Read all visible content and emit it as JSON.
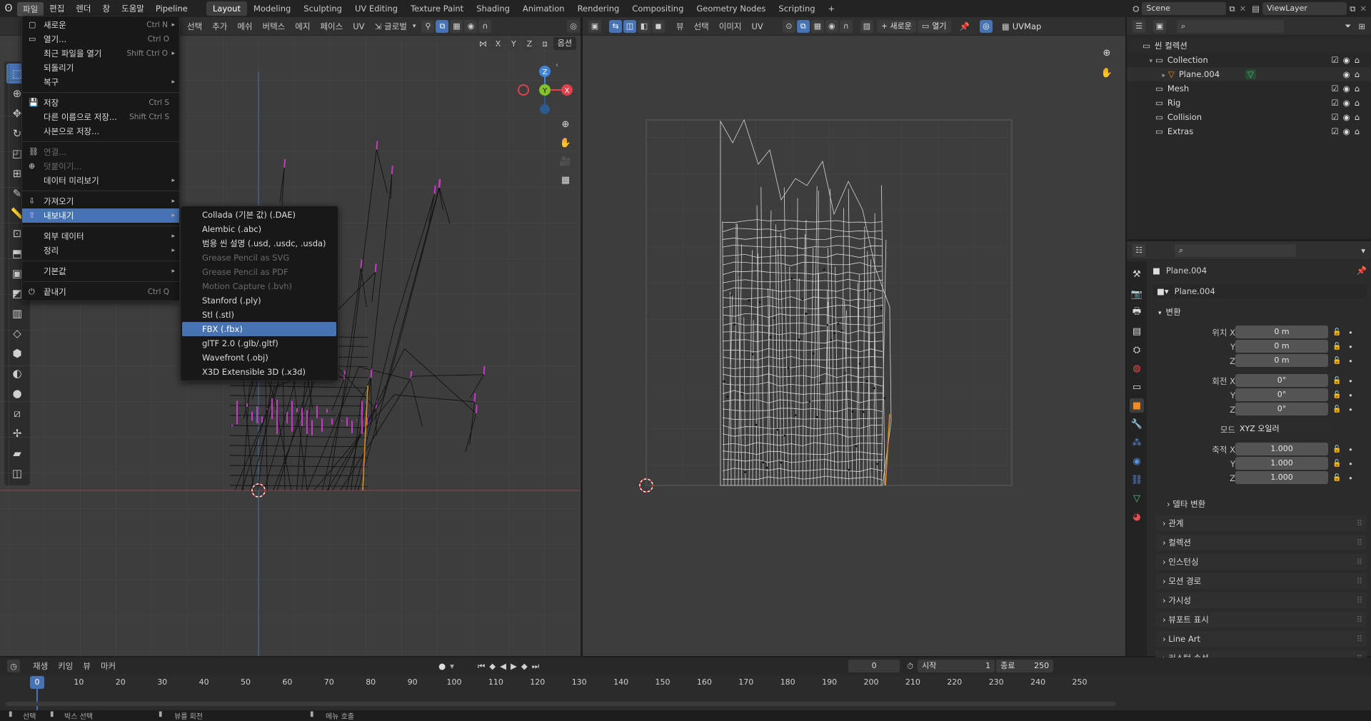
{
  "menubar": {
    "items": [
      "파일",
      "편집",
      "렌더",
      "창",
      "도움말",
      "Pipeline"
    ],
    "workspaces": [
      "Layout",
      "Modeling",
      "Sculpting",
      "UV Editing",
      "Texture Paint",
      "Shading",
      "Animation",
      "Rendering",
      "Compositing",
      "Geometry Nodes",
      "Scripting"
    ],
    "add_tab": "+",
    "scene": "Scene",
    "view_layer": "ViewLayer"
  },
  "file_menu": [
    {
      "label": "새로운",
      "shortcut": "Ctrl N",
      "icon": "new-file-icon",
      "submenu": true
    },
    {
      "label": "열기...",
      "shortcut": "Ctrl O",
      "icon": "folder-icon"
    },
    {
      "label": "최근 파일을 열기",
      "shortcut": "Shift Ctrl O",
      "submenu": true
    },
    {
      "label": "되돌리기"
    },
    {
      "label": "복구",
      "submenu": true
    },
    {
      "sep": true
    },
    {
      "label": "저장",
      "shortcut": "Ctrl S",
      "icon": "save-icon"
    },
    {
      "label": "다른 이름으로 저장...",
      "shortcut": "Shift Ctrl S"
    },
    {
      "label": "사본으로 저장..."
    },
    {
      "sep": true
    },
    {
      "label": "연결...",
      "disabled": true,
      "icon": "link-icon"
    },
    {
      "label": "덧붙이기...",
      "disabled": true,
      "icon": "append-icon"
    },
    {
      "label": "데이터 미리보기",
      "submenu": true
    },
    {
      "sep": true
    },
    {
      "label": "가져오기",
      "icon": "import-icon",
      "submenu": true
    },
    {
      "label": "내보내기",
      "icon": "export-icon",
      "submenu": true,
      "selected": true
    },
    {
      "sep": true
    },
    {
      "label": "외부 데이터",
      "submenu": true
    },
    {
      "label": "정리",
      "submenu": true
    },
    {
      "sep": true
    },
    {
      "label": "기본값",
      "submenu": true
    },
    {
      "sep": true
    },
    {
      "label": "끝내기",
      "shortcut": "Ctrl Q",
      "icon": "power-icon"
    }
  ],
  "export_submenu": [
    {
      "label": "Collada (기본 값) (.DAE)"
    },
    {
      "label": "Alembic (.abc)"
    },
    {
      "label": "범용 씬 설명 (.usd, .usdc, .usda)"
    },
    {
      "label": "Grease Pencil as SVG",
      "disabled": true
    },
    {
      "label": "Grease Pencil as PDF",
      "disabled": true
    },
    {
      "label": "Motion Capture (.bvh)",
      "disabled": true
    },
    {
      "label": "Stanford (.ply)"
    },
    {
      "label": "Stl (.stl)"
    },
    {
      "label": "FBX (.fbx)",
      "selected": true
    },
    {
      "label": "glTF 2.0 (.glb/.gltf)"
    },
    {
      "label": "Wavefront (.obj)"
    },
    {
      "label": "X3D Extensible 3D (.x3d)"
    }
  ],
  "viewport3d": {
    "header_menus": [
      "선택",
      "추가",
      "메쉬",
      "버텍스",
      "에지",
      "페이스"
    ],
    "uv_label": "UV",
    "orientation": "글로벌",
    "options_label": "옵션",
    "axes": [
      "X",
      "Y",
      "Z"
    ],
    "gizmo": {
      "x": "X",
      "y": "Y",
      "z": "Z"
    }
  },
  "uv_editor": {
    "menus": [
      "뷰",
      "선택",
      "이미지",
      "UV"
    ],
    "new_label": "+ 새로운",
    "open_label": "열기",
    "uvmap": "UVMap"
  },
  "outliner": {
    "rows": [
      {
        "label": "씬 컬렉션",
        "indent": 0
      },
      {
        "label": "Collection",
        "indent": 1
      },
      {
        "label": "Plane.004",
        "indent": 2
      },
      {
        "label": "Mesh",
        "indent": 1
      },
      {
        "label": "Rig",
        "indent": 1
      },
      {
        "label": "Collision",
        "indent": 1
      },
      {
        "label": "Extras",
        "indent": 1
      }
    ]
  },
  "properties": {
    "object_name": "Plane.004",
    "data_name": "Plane.004",
    "transform_title": "변환",
    "location_label": "위치 X",
    "location": [
      "0 m",
      "0 m",
      "0 m"
    ],
    "rotation_label": "회전 X",
    "rotation": [
      "0°",
      "0°",
      "0°"
    ],
    "mode_label": "모드",
    "mode_value": "XYZ 오일러",
    "scale_label": "축적 X",
    "scale": [
      "1.000",
      "1.000",
      "1.000"
    ],
    "y_label": "Y",
    "z_label": "Z",
    "delta": "델타 변환",
    "sections": [
      "관계",
      "컬렉션",
      "인스턴싱",
      "모션 경로",
      "가시성",
      "뷰포트 표시",
      "Line Art",
      "커스텀 속성"
    ]
  },
  "timeline": {
    "menus": [
      "재생",
      "키잉",
      "뷰",
      "마커"
    ],
    "current_frame": "0",
    "start_label": "시작",
    "start": "1",
    "end_label": "종료",
    "end": "250",
    "ticks": [
      "0",
      "10",
      "20",
      "30",
      "40",
      "50",
      "60",
      "70",
      "80",
      "90",
      "100",
      "110",
      "120",
      "130",
      "140",
      "150",
      "160",
      "170",
      "180",
      "190",
      "200",
      "210",
      "220",
      "230",
      "240",
      "250"
    ]
  },
  "statusbar": {
    "items": [
      "선택",
      "박스 선택",
      "뷰를 회전",
      "메뉴 호출"
    ]
  },
  "colors": {
    "accent": "#4772b3",
    "selected_edge": "#e08a1e",
    "vertex_normal": "#c43cc4",
    "axis_x": "#e0414c",
    "axis_y": "#84c12d",
    "axis_z": "#3f84d6"
  }
}
